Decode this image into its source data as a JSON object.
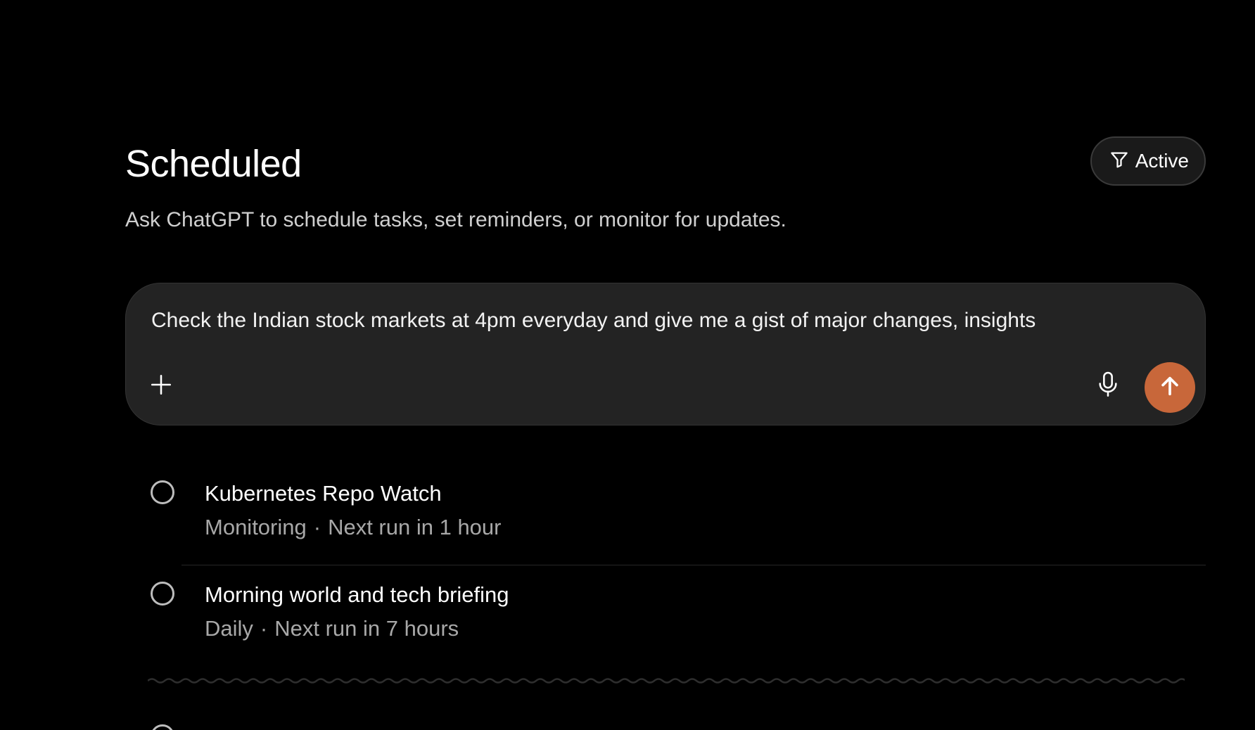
{
  "header": {
    "title": "Scheduled",
    "filter_label": "Active",
    "filter_icon": "filter-funnel-icon"
  },
  "subtitle": "Ask ChatGPT to schedule tasks, set reminders, or monitor for updates.",
  "composer": {
    "value": "Check the Indian stock markets at 4pm everyday and give me a gist of major changes, insights",
    "plus_icon": "plus-icon",
    "mic_icon": "microphone-icon",
    "send_icon": "arrow-up-icon",
    "send_color": "#c8673a"
  },
  "tasks": [
    {
      "title": "Kubernetes Repo Watch",
      "type": "Monitoring",
      "separator": "·",
      "next_run": "Next run in 1 hour"
    },
    {
      "title": "Morning world and tech briefing",
      "type": "Daily",
      "separator": "·",
      "next_run": "Next run in 7 hours"
    }
  ]
}
